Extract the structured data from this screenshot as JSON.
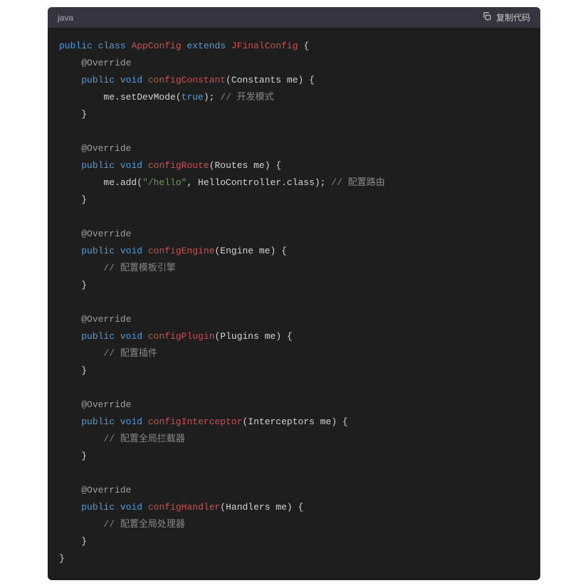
{
  "header": {
    "language": "java",
    "copy_label": "复制代码"
  },
  "code": {
    "k_public": "public",
    "k_class": "class",
    "cls_name": "AppConfig",
    "k_extends": "extends",
    "base_cls": "JFinalConfig",
    "ann_override": "@Override",
    "k_void": "void",
    "fn_configConstant": "configConstant",
    "param_constants": "(Constants me) {",
    "line_setDevMode_a": "        me.setDevMode(",
    "lit_true": "true",
    "line_setDevMode_b": "); ",
    "cmt_devmode": "// 开发模式",
    "brace_close_m": "    }",
    "fn_configRoute": "configRoute",
    "param_routes": "(Routes me) {",
    "line_add_a": "        me.add(",
    "str_hello": "\"/hello\"",
    "line_add_b": ", HelloController.class); ",
    "cmt_route": "// 配置路由",
    "fn_configEngine": "configEngine",
    "param_engine": "(Engine me) {",
    "cmt_engine": "        // 配置模板引擎",
    "fn_configPlugin": "configPlugin",
    "param_plugin": "(Plugins me) {",
    "cmt_plugin": "        // 配置插件",
    "fn_configInterceptor": "configInterceptor",
    "param_interceptor": "(Interceptors me) {",
    "cmt_interceptor": "        // 配置全局拦截器",
    "fn_configHandler": "configHandler",
    "param_handler": "(Handlers me) {",
    "cmt_handler": "        // 配置全局处理器",
    "brace_close_c": "}"
  },
  "below": {
    "text": ""
  }
}
